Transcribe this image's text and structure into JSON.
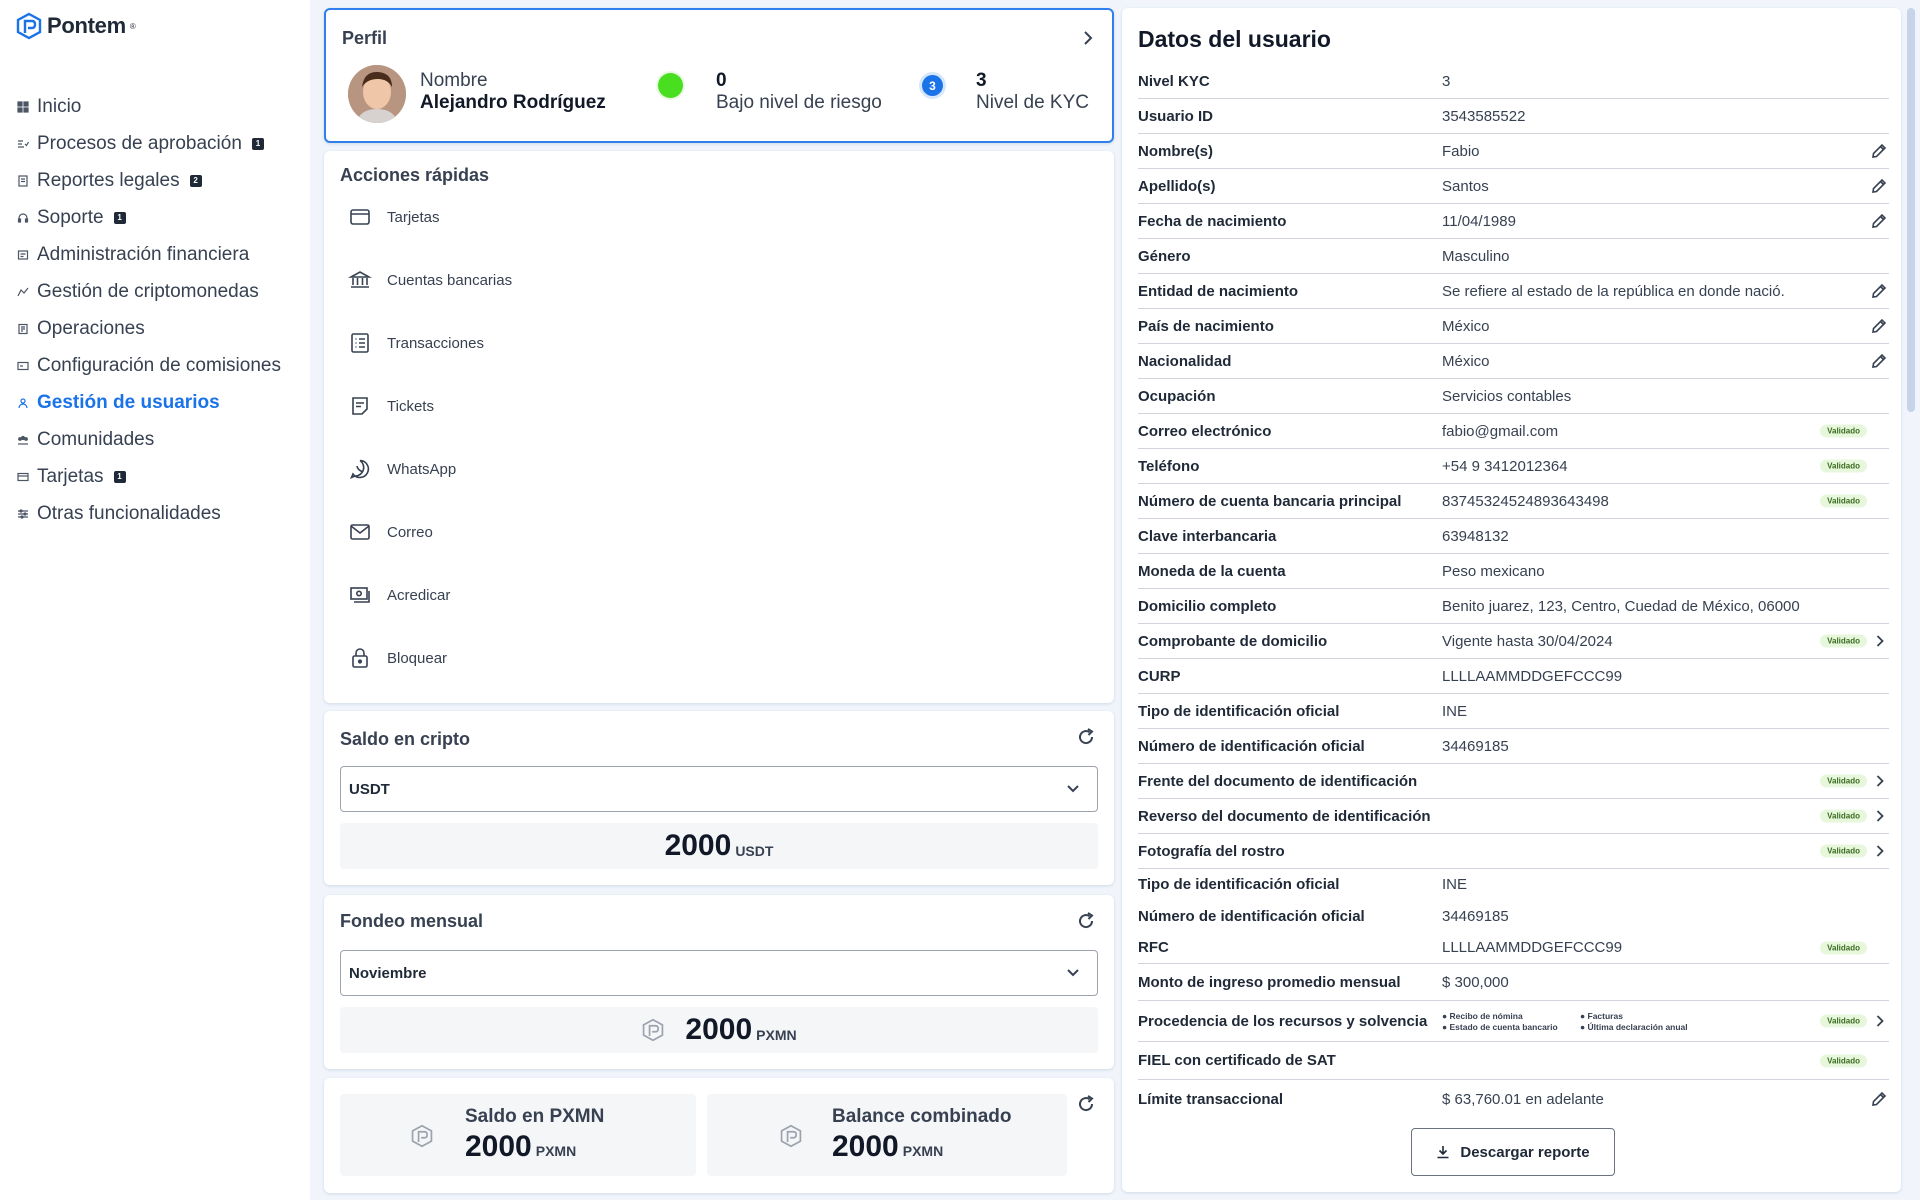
{
  "brand": {
    "name": "Pontem",
    "tm": "®"
  },
  "sidebar": {
    "items": [
      {
        "label": "Inicio",
        "icon": "grid-icon",
        "badge": ""
      },
      {
        "label": "Procesos de aprobación",
        "icon": "approval-icon",
        "badge": "1"
      },
      {
        "label": "Reportes legales",
        "icon": "report-icon",
        "badge": "2"
      },
      {
        "label": "Soporte",
        "icon": "headset-icon",
        "badge": "1"
      },
      {
        "label": "Administración financiera",
        "icon": "finance-icon",
        "badge": ""
      },
      {
        "label": "Gestión de criptomonedas",
        "icon": "crypto-icon",
        "badge": ""
      },
      {
        "label": "Operaciones",
        "icon": "operations-icon",
        "badge": ""
      },
      {
        "label": "Configuración de comisiones",
        "icon": "commission-icon",
        "badge": ""
      },
      {
        "label": "Gestión de usuarios",
        "icon": "users-icon",
        "badge": "",
        "active": true
      },
      {
        "label": "Comunidades",
        "icon": "community-icon",
        "badge": ""
      },
      {
        "label": "Tarjetas",
        "icon": "card-icon",
        "badge": "1"
      },
      {
        "label": "Otras funcionalidades",
        "icon": "sliders-icon",
        "badge": ""
      }
    ]
  },
  "profile": {
    "title": "Perfil",
    "name_label": "Nombre",
    "name": "Alejandro Rodríguez",
    "risk_value": "0",
    "risk_label": "Bajo nivel de riesgo",
    "risk_color": "#4ade20",
    "kyc_badge": "3",
    "kyc_value": "3",
    "kyc_label": "Nivel de KYC"
  },
  "quick_actions": {
    "title": "Acciones rápidas",
    "items": [
      {
        "label": "Tarjetas",
        "icon": "credit-card-icon"
      },
      {
        "label": "Cuentas bancarias",
        "icon": "bank-icon"
      },
      {
        "label": "Transacciones",
        "icon": "list-icon"
      },
      {
        "label": "Tickets",
        "icon": "ticket-icon"
      },
      {
        "label": "WhatsApp",
        "icon": "whatsapp-icon"
      },
      {
        "label": "Correo",
        "icon": "mail-icon"
      },
      {
        "label": "Acredicar",
        "icon": "cash-icon"
      },
      {
        "label": "Bloquear",
        "icon": "lock-icon"
      }
    ]
  },
  "crypto_balance": {
    "title": "Saldo en cripto",
    "selected": "USDT",
    "amount": "2000",
    "unit": "USDT"
  },
  "monthly_funding": {
    "title": "Fondeo mensual",
    "selected": "Noviembre",
    "amount": "2000",
    "unit": "PXMN"
  },
  "balances": {
    "pxmn_label": "Saldo en PXMN",
    "pxmn_amount": "2000",
    "pxmn_unit": "PXMN",
    "combined_label": "Balance combinado",
    "combined_amount": "2000",
    "combined_unit": "PXMN"
  },
  "user_data": {
    "title": "Datos del usuario",
    "validated_label": "Validado",
    "download_label": "Descargar reporte",
    "rows": [
      {
        "label": "Nivel KYC",
        "value": "3"
      },
      {
        "label": "Usuario ID",
        "value": "3543585522"
      },
      {
        "label": "Nombre(s)",
        "value": "Fabio",
        "edit": true
      },
      {
        "label": "Apellido(s)",
        "value": "Santos",
        "edit": true
      },
      {
        "label": "Fecha de nacimiento",
        "value": "11/04/1989",
        "edit": true
      },
      {
        "label": "Género",
        "value": "Masculino"
      },
      {
        "label": "Entidad de nacimiento",
        "value": "Se refiere al estado de la república en donde nació.",
        "edit": true
      },
      {
        "label": "País de nacimiento",
        "value": "México",
        "edit": true
      },
      {
        "label": "Nacionalidad",
        "value": "México",
        "edit": true
      },
      {
        "label": "Ocupación",
        "value": "Servicios contables"
      },
      {
        "label": "Correo electrónico",
        "value": "fabio@gmail.com",
        "validated": true
      },
      {
        "label": "Teléfono",
        "value": "+54  9  3412012364",
        "validated": true
      },
      {
        "label": "Número de cuenta bancaria principal",
        "value": "83745324524893643498",
        "validated": true
      },
      {
        "label": "Clave interbancaria",
        "value": "63948132"
      },
      {
        "label": "Moneda de la cuenta",
        "value": "Peso mexicano"
      },
      {
        "label": "Domicilio completo",
        "value": "Benito juarez, 123, Centro, Cuedad de México, 06000"
      },
      {
        "label": "Comprobante de domicilio",
        "value": "Vigente hasta  30/04/2024",
        "validated": true,
        "arrow": true
      },
      {
        "label": "CURP",
        "value": "LLLLAAMMDDGEFCCC99"
      },
      {
        "label": "Tipo de identificación oficial",
        "value": "INE"
      },
      {
        "label": "Número de identificación oficial",
        "value": "34469185"
      },
      {
        "label": "Frente del documento de identificación",
        "value": "",
        "validated": true,
        "arrow": true
      },
      {
        "label": "Reverso del documento de identificación",
        "value": "",
        "validated": true,
        "arrow": true
      },
      {
        "label": "Fotografía del rostro",
        "value": "",
        "validated": true,
        "arrow": true
      },
      {
        "label": "Tipo de identificación oficial",
        "value": "INE",
        "noline": true,
        "h": 31
      },
      {
        "label": "Número de identificación oficial",
        "value": "34469185",
        "noline": true,
        "h": 32
      },
      {
        "label": "RFC",
        "value": "LLLLAAMMDDGEFCCC99",
        "validated": true,
        "h": 32
      },
      {
        "label": "Monto de ingreso promedio mensual",
        "value": "$ 300,000",
        "h": 37
      },
      {
        "label": "Procedencia de los recursos y solvencia",
        "bullets": [
          "● Recibo de nómina",
          "● Facturas",
          "● Estado de cuenta bancario",
          "● Última declaración anual"
        ],
        "validated": true,
        "arrow": true,
        "h": 41
      },
      {
        "label": "FIEL con certificado de SAT",
        "value": "",
        "validated": true,
        "h": 38
      },
      {
        "label": "Límite transaccional",
        "value": "$ 63,760.01 en adelante",
        "edit": true,
        "noline": true,
        "h": 38
      }
    ]
  }
}
